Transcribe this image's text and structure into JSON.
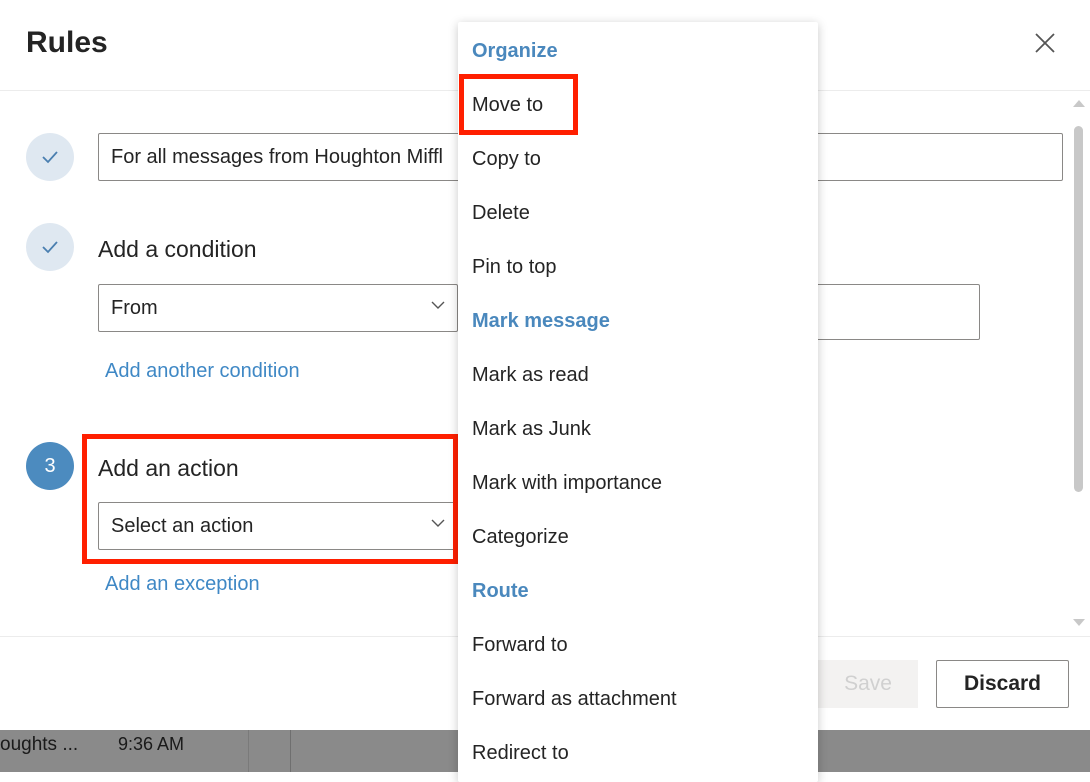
{
  "dialog": {
    "title": "Rules",
    "rule_name_value": "For all messages from Houghton Miffl",
    "condition": {
      "label": "Add a condition",
      "selected": "From",
      "add_another": "Add another condition"
    },
    "action": {
      "step_number": "3",
      "label": "Add an action",
      "placeholder": "Select an action",
      "add_exception": "Add an exception"
    },
    "buttons": {
      "save": "Save",
      "discard": "Discard"
    }
  },
  "action_menu": {
    "groups": [
      {
        "header": "Organize",
        "items": [
          "Move to",
          "Copy to",
          "Delete",
          "Pin to top"
        ]
      },
      {
        "header": "Mark message",
        "items": [
          "Mark as read",
          "Mark as Junk",
          "Mark with importance",
          "Categorize"
        ]
      },
      {
        "header": "Route",
        "items": [
          "Forward to",
          "Forward as attachment",
          "Redirect to"
        ]
      }
    ]
  },
  "background_list": {
    "preview": "oughts ...",
    "time": "9:36 AM"
  },
  "colors": {
    "accent": "#4c8bbf",
    "link": "#3f88c5",
    "highlight": "#ff1f00",
    "step_done_bg": "#dfe8f1"
  },
  "icons": {
    "close": "close-icon",
    "check": "checkmark-icon",
    "chevron": "chevron-down-icon"
  }
}
